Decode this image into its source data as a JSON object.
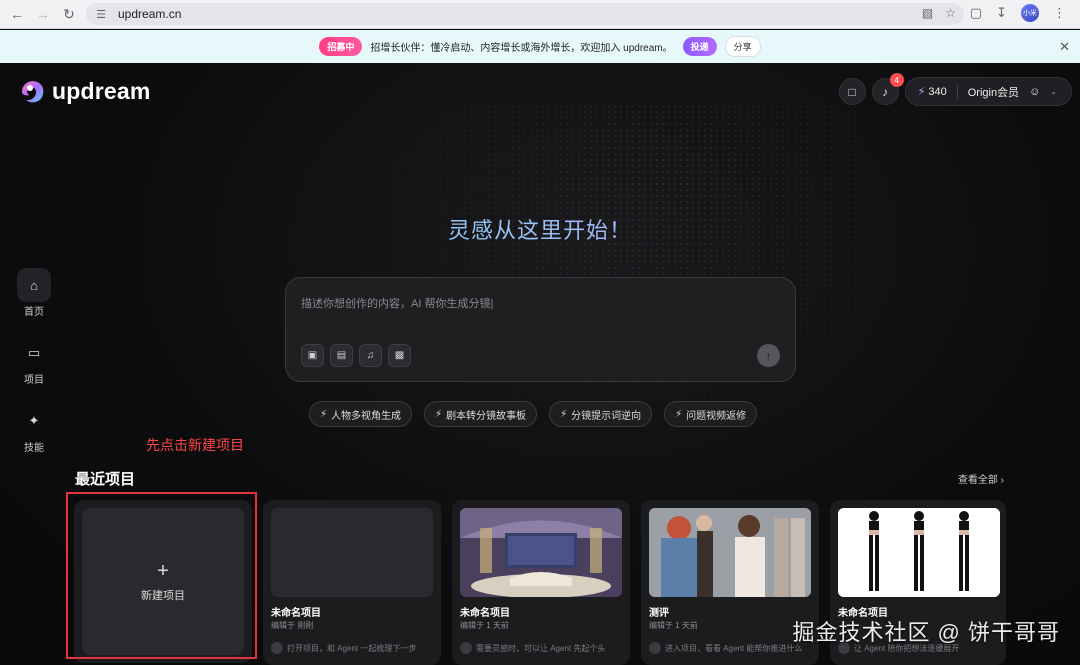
{
  "browser": {
    "url": "updream.cn",
    "profile_initials": "小米"
  },
  "banner": {
    "tag": "招募中",
    "text": "招增长伙伴：懂冷启动、内容增长或海外增长，欢迎加入 updream。",
    "apply_label": "投递",
    "share_label": "分享"
  },
  "app": {
    "logo_text": "updream",
    "notification_count": "4",
    "credits": "340",
    "membership": "Origin会员",
    "hero_title": "灵感从这里开始！",
    "prompt_placeholder": "描述你想创作的内容，AI 帮你生成分镜|",
    "sidebar": [
      {
        "label": "首页",
        "icon": "home-icon"
      },
      {
        "label": "项目",
        "icon": "folder-icon"
      },
      {
        "label": "技能",
        "icon": "sparkle-icon"
      }
    ],
    "chips": [
      "人物多视角生成",
      "剧本转分镜故事板",
      "分镜提示词逆向",
      "问题视频返修"
    ],
    "annotation": "先点击新建项目",
    "recent_title": "最近项目",
    "view_all": "查看全部",
    "new_project_label": "新建项目",
    "projects": [
      {
        "title": "未命名项目",
        "meta": "编辑于 刚刚",
        "desc": "打开项目，和 Agent 一起梳理下一步"
      },
      {
        "title": "未命名项目",
        "meta": "编辑于 1 天前",
        "desc": "需要灵感时，可以让 Agent 先起个头"
      },
      {
        "title": "测评",
        "meta": "编辑于 1 天前",
        "desc": "进入项目，看看 Agent 能帮你推进什么"
      },
      {
        "title": "未命名项目",
        "meta": "",
        "desc": "让 Agent 陪你把想法逐缓展开"
      }
    ],
    "watermark": "掘金技术社区 @ 饼干哥哥"
  },
  "colors": {
    "accent_red": "#e0353b",
    "hero_gradient_start": "#7fe3f0",
    "hero_gradient_end": "#b79bff"
  }
}
